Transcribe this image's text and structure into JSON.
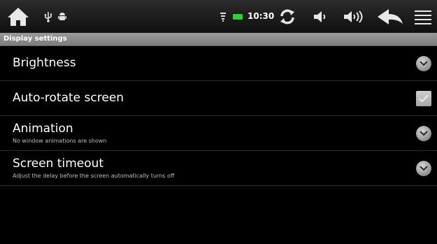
{
  "status_bar": {
    "time": "10:30",
    "icons": [
      "home-icon",
      "usb-icon",
      "android-debug-icon",
      "wifi-icon",
      "battery-icon",
      "sync-icon",
      "volume-down-icon",
      "volume-up-icon",
      "back-icon",
      "menu-icon"
    ],
    "battery_color": "#2fd02f"
  },
  "title_bar": {
    "title": "Display settings"
  },
  "settings": [
    {
      "title": "Brightness",
      "summary": "",
      "widget": "chevron"
    },
    {
      "title": "Auto-rotate screen",
      "summary": "",
      "widget": "checkbox",
      "checked": true
    },
    {
      "title": "Animation",
      "summary": "No window animations are shown",
      "widget": "chevron"
    },
    {
      "title": "Screen timeout",
      "summary": "Adjust the delay before the screen automatically turns off",
      "widget": "chevron"
    }
  ]
}
